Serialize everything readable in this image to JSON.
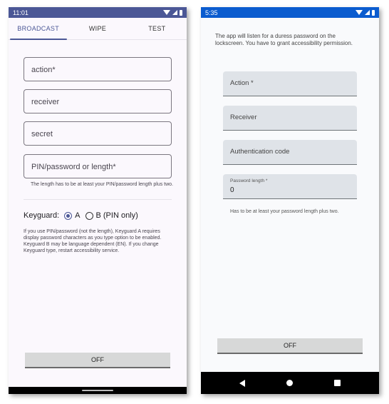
{
  "screen1": {
    "status": {
      "time": "11:01"
    },
    "tabs": [
      {
        "label": "BROADCAST",
        "active": true
      },
      {
        "label": "WIPE",
        "active": false
      },
      {
        "label": "TEST",
        "active": false
      }
    ],
    "fields": {
      "action": {
        "placeholder": "action*"
      },
      "receiver": {
        "placeholder": "receiver"
      },
      "secret": {
        "placeholder": "secret"
      },
      "pin": {
        "placeholder": "PIN/password or length*"
      }
    },
    "pin_helper": "The length has to be at least your PIN/password length plus two.",
    "keyguard": {
      "label": "Keyguard:",
      "options": [
        {
          "label": "A",
          "selected": true
        },
        {
          "label": "B (PIN only)",
          "selected": false
        }
      ],
      "description": "If you use PIN/password (not the length), Keyguard A requires display password characters as you type option to be enabled. Keyguard B may be language dependent (EN). If you change Keyguard type, restart accessibility service."
    },
    "toggle_button": "OFF",
    "colors": {
      "statusbar": "#4b5796",
      "accent": "#4b5796"
    }
  },
  "screen2": {
    "status": {
      "time": "5:35"
    },
    "intro": "The app will listen for a duress password on the lockscreen. You have to grant accessibility permission.",
    "fields": {
      "action": {
        "placeholder": "Action *"
      },
      "receiver": {
        "placeholder": "Receiver"
      },
      "auth": {
        "placeholder": "Authentication code"
      },
      "password_length": {
        "label": "Password length *",
        "value": "0"
      }
    },
    "password_helper": "Has to be at least your password length plus two.",
    "toggle_button": "OFF",
    "colors": {
      "statusbar": "#0b5ccf"
    }
  }
}
